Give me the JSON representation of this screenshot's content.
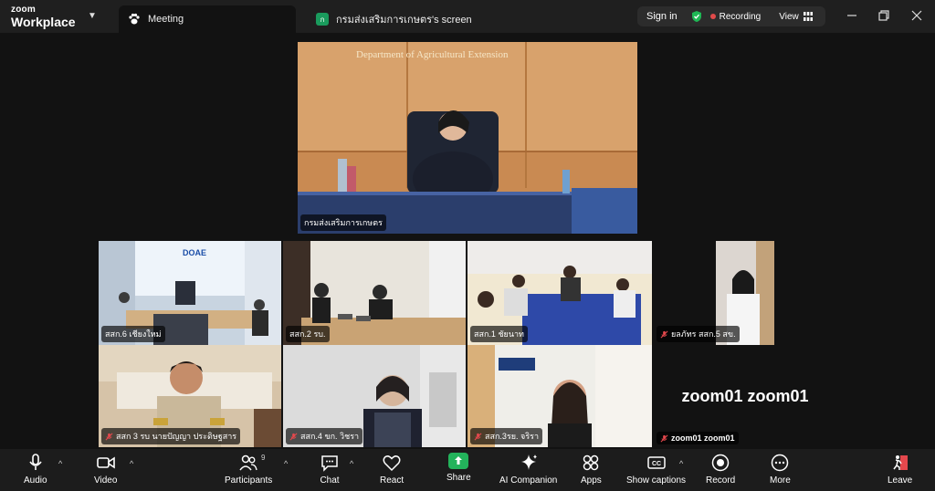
{
  "titlebar": {
    "brand_line1": "zoom",
    "brand_line2": "Workplace",
    "tab_meeting": "Meeting",
    "tab_screen": "กรมส่งเสริมการเกษตร's screen",
    "sign_in": "Sign in",
    "recording": "Recording",
    "view": "View"
  },
  "tiles": {
    "presenter_sign": "Department of Agricultural Extension",
    "presenter": "กรมส่งเสริมการเกษตร",
    "t1": "สสก.6 เชียงใหม่",
    "t2": "สสก.2 รบ.",
    "t3": "สสก.1 ชัยนาท",
    "t4": "ยลภัทร สสก.5 สข.",
    "t5": "สสก 3 รบ นายปัญญา ประดิษฐสาร",
    "t6": "สสก.4 ขก. วิชรา",
    "t7": "สสก.3รย. จริรา",
    "t8": "zoom01 zoom01",
    "t8_big": "zoom01 zoom01",
    "t1_banner": "DOAE"
  },
  "toolbar": {
    "audio": "Audio",
    "video": "Video",
    "participants": "Participants",
    "participants_count": "9",
    "chat": "Chat",
    "react": "React",
    "share": "Share",
    "ai": "AI Companion",
    "apps": "Apps",
    "captions": "Show captions",
    "record": "Record",
    "more": "More",
    "leave": "Leave"
  },
  "colors": {
    "share_green": "#23b35b",
    "recording_red": "#e04a4a",
    "leave_red": "#e5484d",
    "shield_green": "#1fb855"
  }
}
